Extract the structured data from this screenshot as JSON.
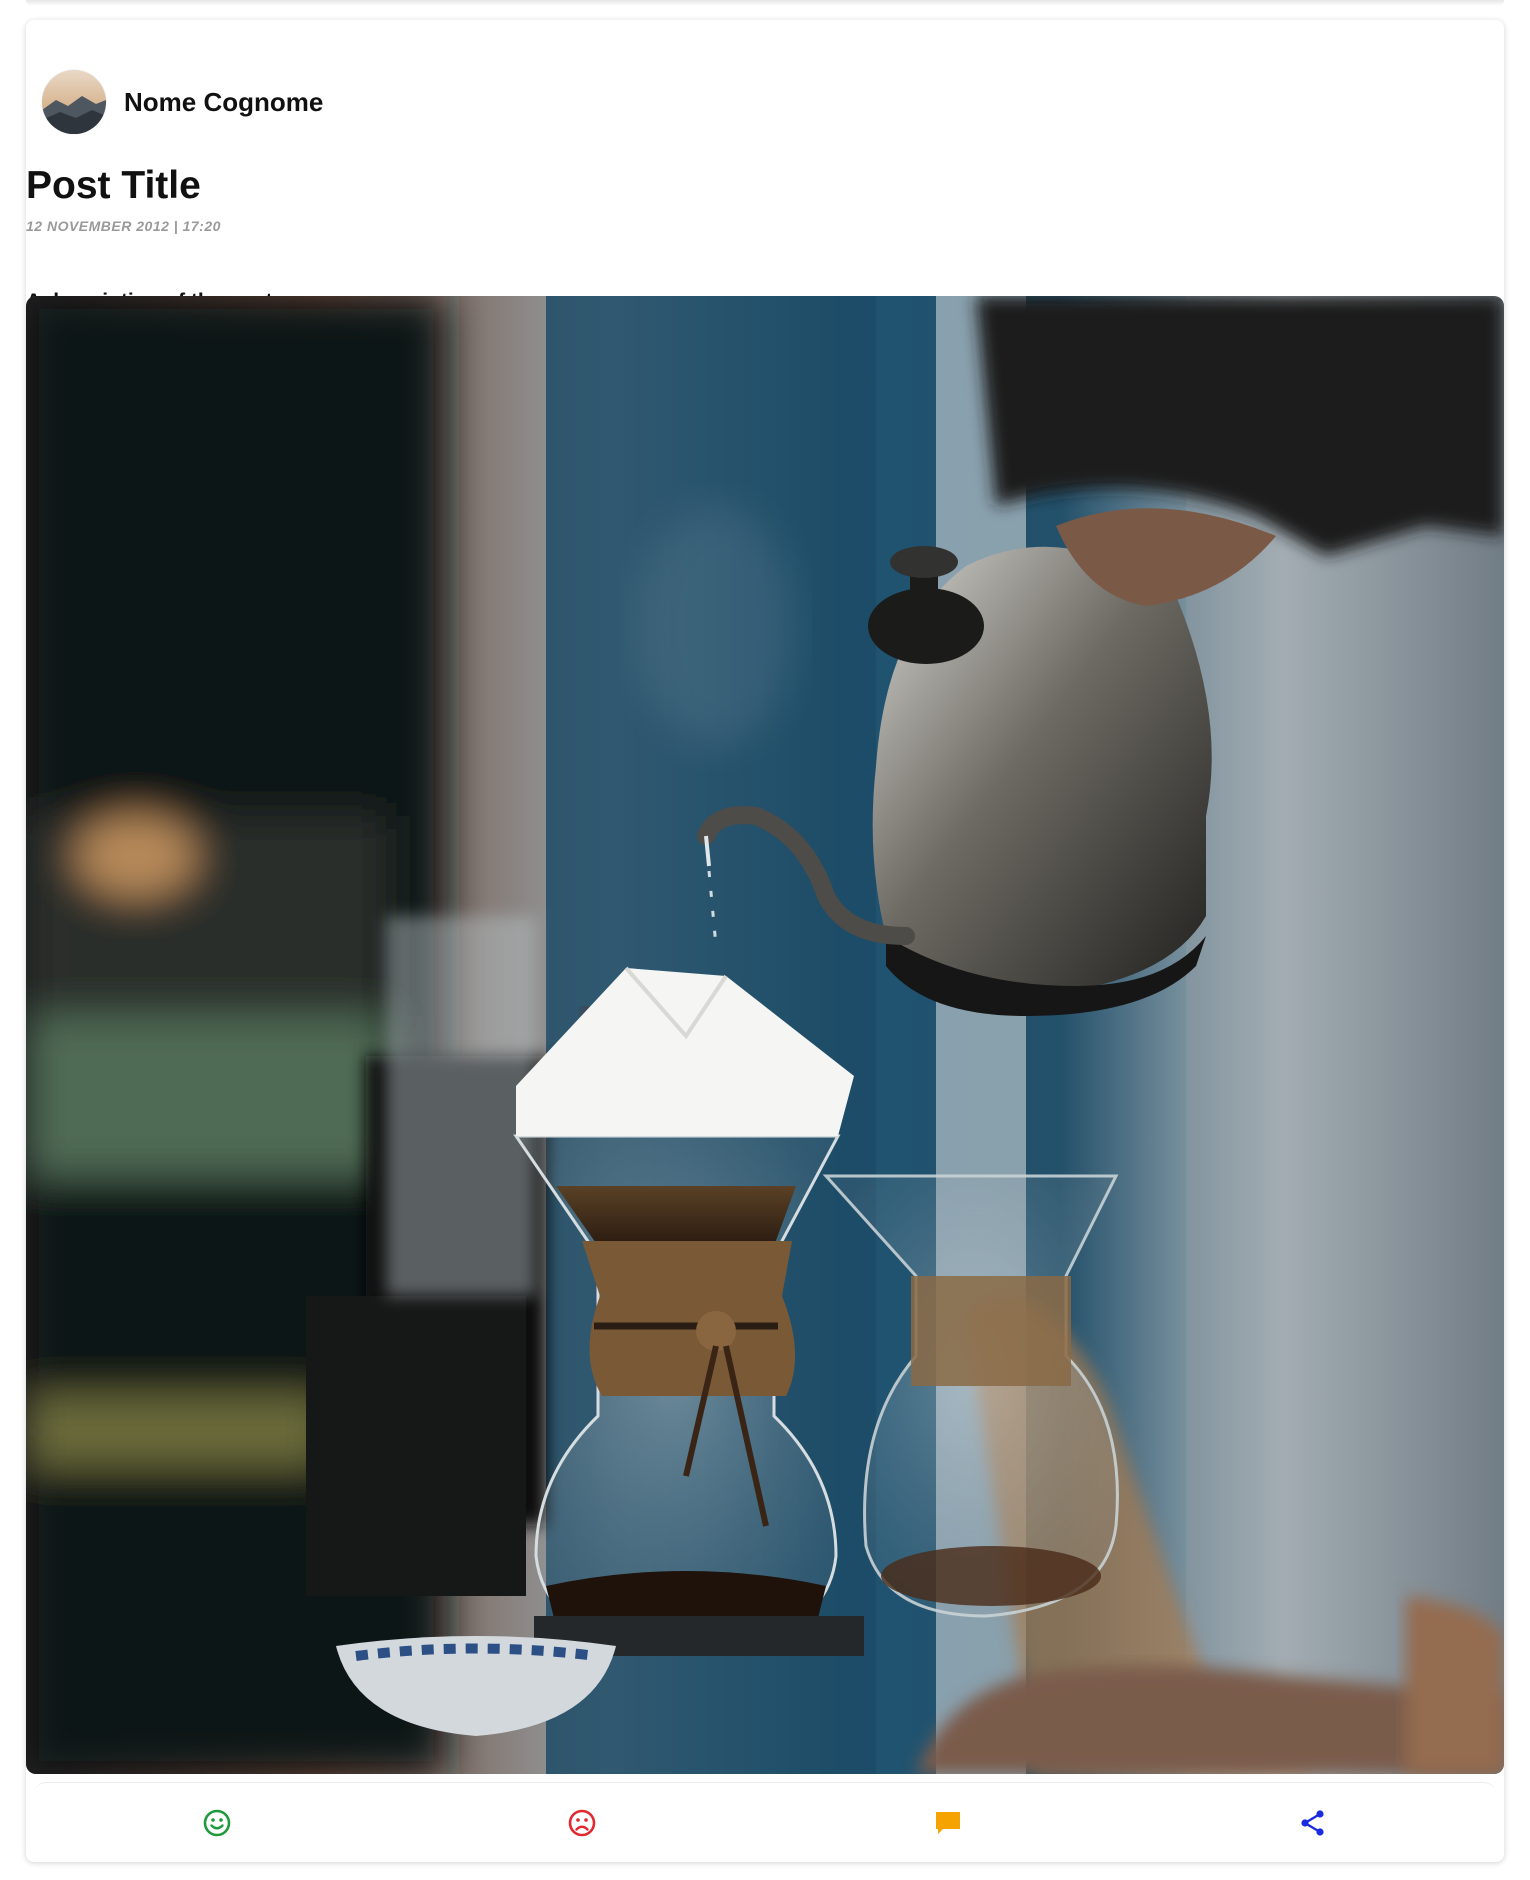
{
  "post": {
    "author": {
      "name": "Nome Cognome",
      "avatar_icon": "avatar-landscape-photo"
    },
    "title": "Post Title",
    "date": "12 NOVEMBER 2012 | 17:20",
    "description": "A description of the post",
    "image_icon": "pour-over-coffee-photo"
  },
  "actions": [
    {
      "name": "like",
      "icon": "smile-icon",
      "color": "#1e9a3a"
    },
    {
      "name": "dislike",
      "icon": "frown-icon",
      "color": "#e0282e"
    },
    {
      "name": "comment",
      "icon": "comment-icon",
      "color": "#f5a300"
    },
    {
      "name": "share",
      "icon": "share-icon",
      "color": "#1a2be0"
    }
  ]
}
